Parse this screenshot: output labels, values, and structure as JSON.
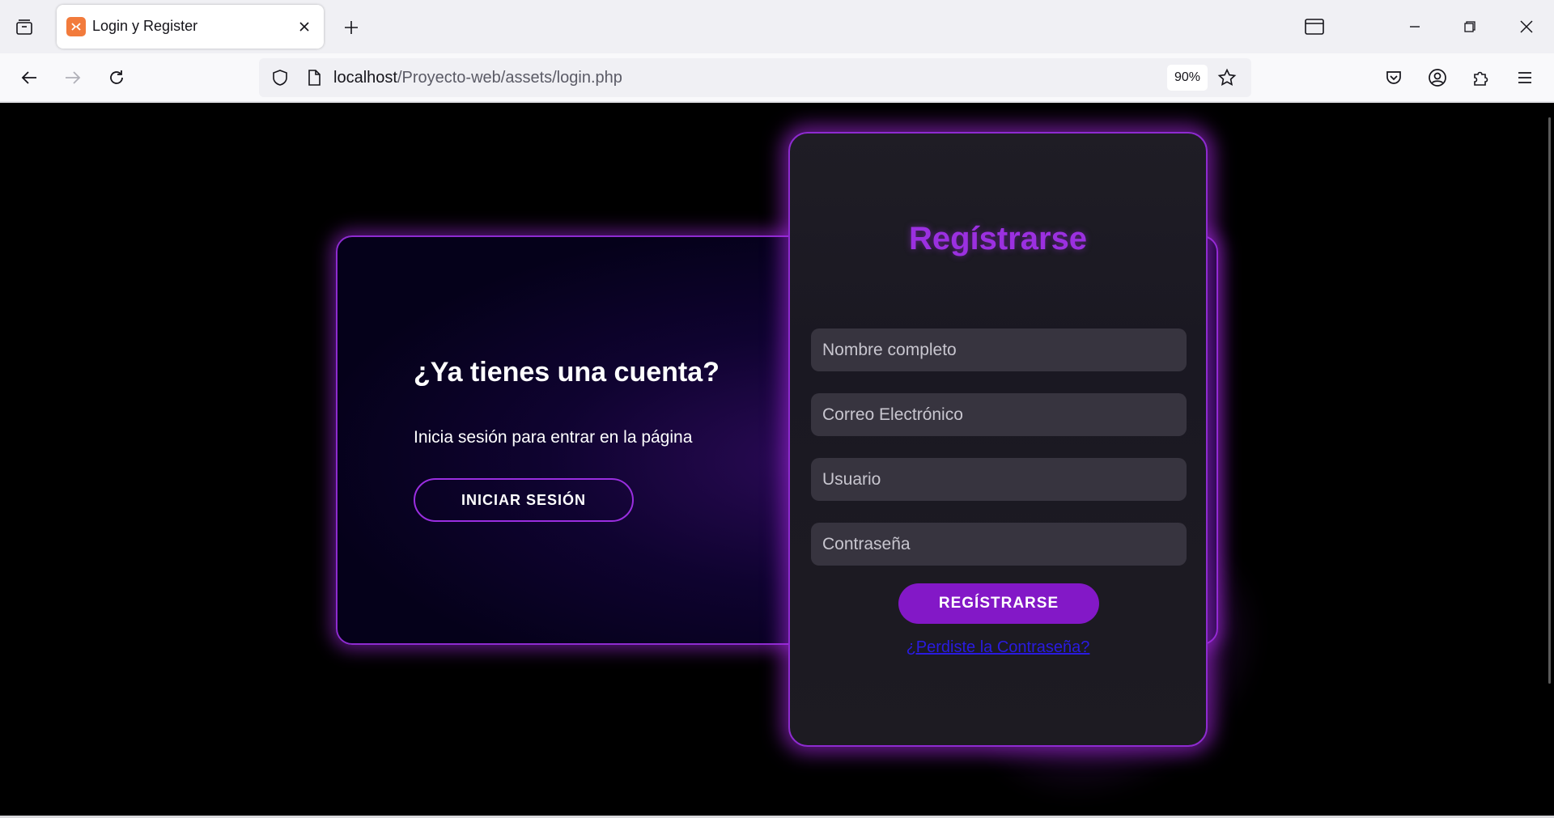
{
  "browser": {
    "tab": {
      "title": "Login y Register"
    },
    "url": {
      "host": "localhost",
      "path": "/Proyecto-web/assets/login.php"
    },
    "zoom": "90%"
  },
  "page": {
    "login_panel": {
      "title": "¿Ya tienes una cuenta?",
      "subtitle": "Inicia sesión para entrar en la página",
      "button": "INICIAR SESIÓN"
    },
    "register_panel": {
      "title": "Regístrarse",
      "fields": [
        {
          "placeholder": "Nombre completo"
        },
        {
          "placeholder": "Correo Electrónico"
        },
        {
          "placeholder": "Usuario"
        },
        {
          "placeholder": "Contraseña"
        }
      ],
      "button": "REGÍSTRARSE",
      "forgot_link": "¿Perdiste la Contraseña?"
    }
  },
  "colors": {
    "accent": "#8e2bd0",
    "button_fill": "#8318c7",
    "title": "#9b30e0",
    "link": "#2a1be0"
  }
}
